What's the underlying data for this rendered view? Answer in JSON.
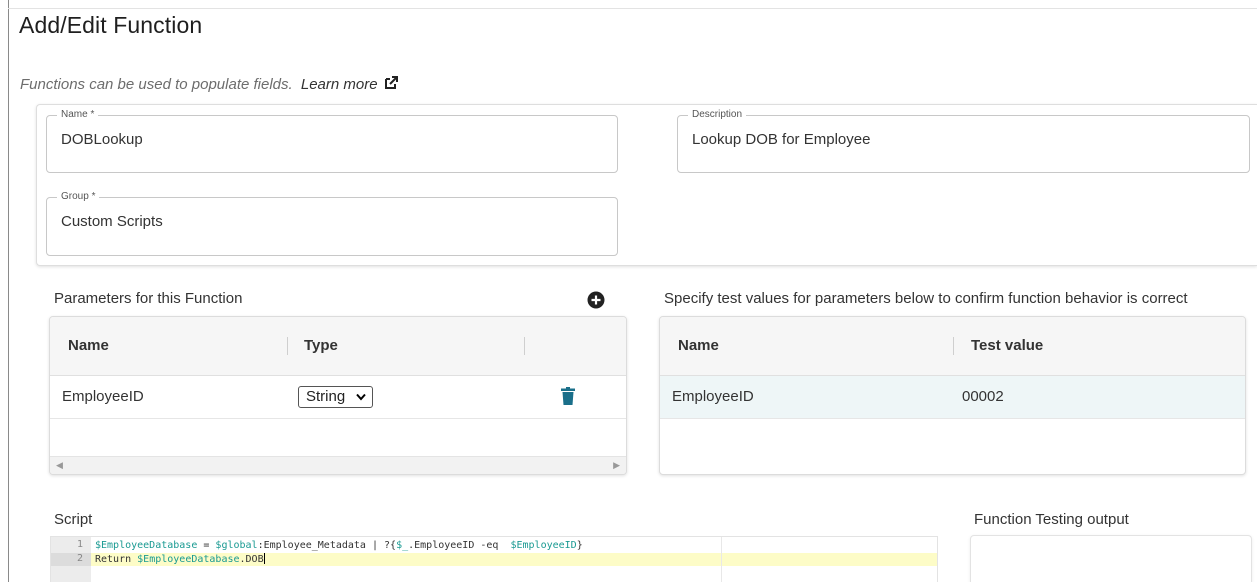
{
  "page": {
    "title": "Add/Edit Function",
    "subtitle": "Functions can be used to populate fields.",
    "learn_more": "Learn more"
  },
  "fields": {
    "name": {
      "label": "Name *",
      "value": "DOBLookup"
    },
    "description": {
      "label": "Description",
      "value": "Lookup DOB for Employee"
    },
    "group": {
      "label": "Group *",
      "value": "Custom Scripts"
    }
  },
  "parameters": {
    "title": "Parameters for this Function",
    "columns": [
      "Name",
      "Type"
    ],
    "rows": [
      {
        "name": "EmployeeID",
        "type": "String"
      }
    ]
  },
  "test_values": {
    "title": "Specify test values for parameters below to confirm function behavior is correct",
    "columns": [
      "Name",
      "Test value"
    ],
    "rows": [
      {
        "name": "EmployeeID",
        "value": "00002"
      }
    ]
  },
  "script": {
    "label": "Script",
    "line_numbers": [
      "1",
      "2"
    ],
    "lines": [
      "$EmployeeDatabase = $global:Employee_Metadata | ?{$_.EmployeeID -eq  $EmployeeID}",
      "Return $EmployeeDatabase.DOB"
    ]
  },
  "output": {
    "label": "Function Testing output"
  },
  "colors": {
    "accent": "#1a6f8a",
    "code_variable": "#1a9a92",
    "active_line": "#fdfcc7",
    "selected_row": "#eef6f7"
  }
}
